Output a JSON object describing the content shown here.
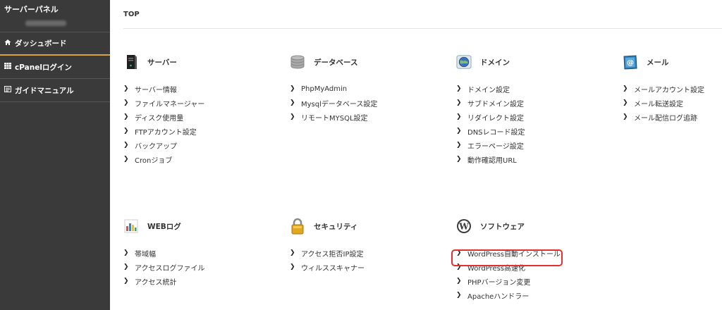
{
  "sidebar": {
    "title": "サーバーパネル",
    "items": [
      {
        "icon": "home-icon",
        "label": "ダッシュボード"
      },
      {
        "icon": "grid-icon",
        "label": "cPanelログイン"
      },
      {
        "icon": "book-icon",
        "label": "ガイドマニュアル"
      }
    ]
  },
  "main": {
    "page_title": "TOP",
    "sections": [
      {
        "title": "サーバー",
        "icon": "server-icon",
        "links": [
          "サーバー情報",
          "ファイルマネージャー",
          "ディスク使用量",
          "FTPアカウント設定",
          "バックアップ",
          "Cronジョブ"
        ]
      },
      {
        "title": "データベース",
        "icon": "database-icon",
        "links": [
          "PhpMyAdmin",
          "Mysqlデータベース設定",
          "リモートMYSQL設定"
        ]
      },
      {
        "title": "ドメイン",
        "icon": "globe-icon",
        "links": [
          "ドメイン設定",
          "サブドメイン設定",
          "リダイレクト設定",
          "DNSレコード設定",
          "エラーページ設定",
          "動作確認用URL"
        ]
      },
      {
        "title": "メール",
        "icon": "mail-icon",
        "links": [
          "メールアカウント設定",
          "メール転送設定",
          "メール配信ログ追跡"
        ]
      },
      {
        "title": "WEBログ",
        "icon": "bar-chart-icon",
        "links": [
          "帯域幅",
          "アクセスログファイル",
          "アクセス統計"
        ]
      },
      {
        "title": "セキュリティ",
        "icon": "lock-icon",
        "links": [
          "アクセス拒否IP設定",
          "ウィルススキャナー"
        ]
      },
      {
        "title": "ソフトウェア",
        "icon": "wordpress-icon",
        "links": [
          "WordPress自動インストール",
          "WordPress高速化",
          "PHPバージョン変更",
          "Apacheハンドラー"
        ]
      }
    ]
  },
  "colors": {
    "sidebar_bg": "#3a3a3a",
    "accent": "#d9a33b",
    "highlight": "#e03030"
  }
}
